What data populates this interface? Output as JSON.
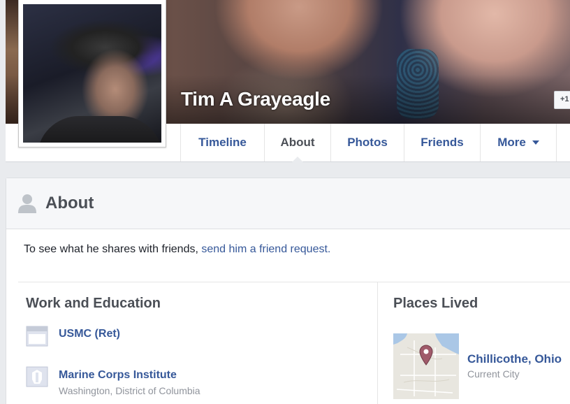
{
  "profile": {
    "name": "Tim A Grayeagle",
    "add_friend_label": "+1"
  },
  "nav": {
    "tabs": [
      {
        "label": "Timeline"
      },
      {
        "label": "About"
      },
      {
        "label": "Photos"
      },
      {
        "label": "Friends"
      },
      {
        "label": "More"
      }
    ],
    "active_tab": "About"
  },
  "about": {
    "title": "About",
    "notice_prefix": "To see what he shares with friends, ",
    "notice_link": "send him a friend request."
  },
  "work_education": {
    "title": "Work and Education",
    "entries": [
      {
        "name": "USMC (Ret)",
        "detail": "",
        "icon": "briefcase-icon"
      },
      {
        "name": "Marine Corps Institute",
        "detail": "Washington, District of Columbia",
        "icon": "school-icon"
      }
    ]
  },
  "places_lived": {
    "title": "Places Lived",
    "entries": [
      {
        "name": "Chillicothe, Ohio",
        "detail": "Current City",
        "icon": "map-pin-icon"
      }
    ]
  },
  "colors": {
    "link": "#365899",
    "page_background": "#e9ebee",
    "muted_text": "#90949c",
    "map_pin": "#a05a6a"
  }
}
